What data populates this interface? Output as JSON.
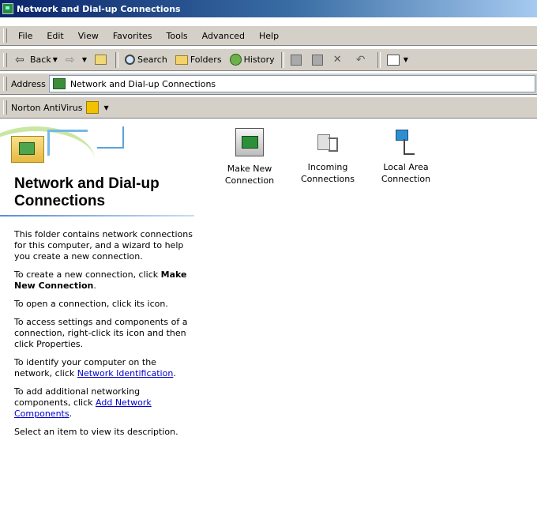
{
  "window": {
    "title": "Network and Dial-up Connections"
  },
  "menubar": {
    "items": [
      "File",
      "Edit",
      "View",
      "Favorites",
      "Tools",
      "Advanced",
      "Help"
    ]
  },
  "toolbar": {
    "back": "Back",
    "search": "Search",
    "folders": "Folders",
    "history": "History"
  },
  "address": {
    "label": "Address",
    "value": "Network and Dial-up Connections"
  },
  "norton": {
    "label": "Norton AntiVirus"
  },
  "leftpane": {
    "title": "Network and Dial-up Connections",
    "p1": "This folder contains network connections for this computer, and a wizard to help you create a new connection.",
    "p2_prefix": "To create a new connection, click ",
    "p2_bold": "Make New Connection",
    "p2_suffix": ".",
    "p3": "To open a connection, click its icon.",
    "p4": "To access settings and components of a connection, right-click its icon and then click Properties.",
    "p5_prefix": "To identify your computer on the network, click ",
    "p5_link": "Network Identification",
    "p5_suffix": ".",
    "p6_prefix": "To add additional networking components, click ",
    "p6_link": "Add Network Components",
    "p6_suffix": ".",
    "p7": "Select an item to view its description."
  },
  "items": [
    {
      "label": "Make New Connection",
      "icon": "make-new-connection-icon"
    },
    {
      "label": "Incoming Connections",
      "icon": "incoming-connections-icon"
    },
    {
      "label": "Local Area Connection",
      "icon": "local-area-connection-icon"
    }
  ]
}
